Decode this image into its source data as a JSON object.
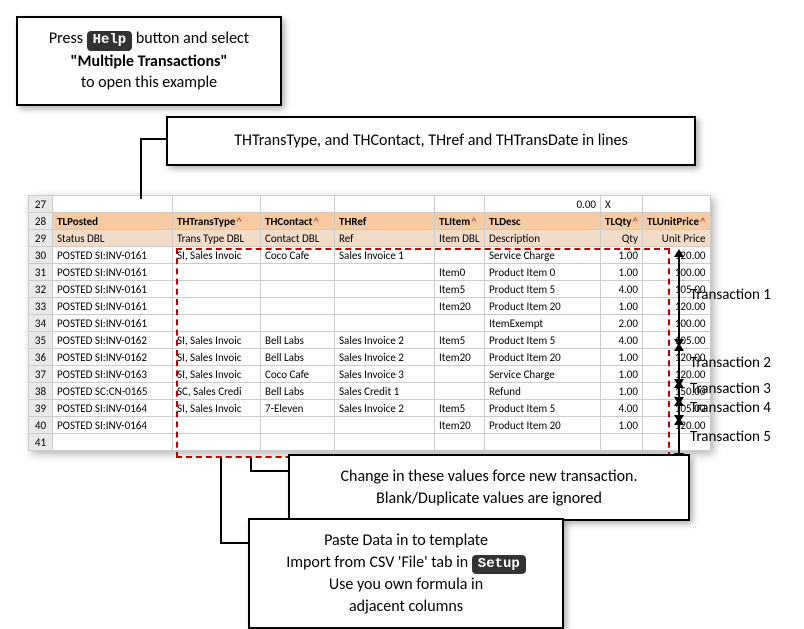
{
  "callouts": {
    "help_line1_pre": "Press ",
    "help_btn": "Help",
    "help_line1_post": " button and select",
    "help_line2": "\"Multiple Transactions\"",
    "help_line3": "to open this example",
    "top_right": "THTransType, and THContact, THref and THTransDate in lines",
    "mid_line1": "Change in these values force new transaction.",
    "mid_line2": "Blank/Duplicate values are ignored",
    "bot_line1": "Paste Data in to template",
    "bot_line2_pre": "Import from CSV 'File' tab in ",
    "bot_pill": "Setup",
    "bot_line3": "Use you own formula in",
    "bot_line4": "adjacent columns"
  },
  "tx_labels": [
    "Transaction 1",
    "Transaction 2",
    "Transaction 3",
    "Transaction 4",
    "Transaction 5"
  ],
  "sheet": {
    "rownums": [
      "27",
      "28",
      "29",
      "30",
      "31",
      "32",
      "33",
      "34",
      "35",
      "36",
      "37",
      "38",
      "39",
      "40",
      "41"
    ],
    "status_cell": {
      "value": "0.00",
      "flag": "X"
    },
    "header1": [
      "TLPosted",
      "THTransType",
      "THContact",
      "THRef",
      "TLItem",
      "TLDesc",
      "TLQty",
      "TLUnitPrice"
    ],
    "header2": [
      "Status DBL",
      "Trans Type DBL",
      "Contact DBL",
      "Ref",
      "Item DBL",
      "Description",
      "Qty",
      "Unit Price"
    ],
    "rows": [
      {
        "posted": "POSTED SI:INV-0161",
        "type": "SI, Sales Invoic",
        "contact": "Coco Cafe",
        "ref": "Sales Invoice 1",
        "item": "",
        "desc": "Service Charge",
        "qty": "1.00",
        "price": "120.00"
      },
      {
        "posted": "POSTED SI:INV-0161",
        "type": "",
        "contact": "",
        "ref": "",
        "item": "Item0",
        "desc": "Product Item 0",
        "qty": "1.00",
        "price": "100.00"
      },
      {
        "posted": "POSTED SI:INV-0161",
        "type": "",
        "contact": "",
        "ref": "",
        "item": "Item5",
        "desc": "Product Item 5",
        "qty": "4.00",
        "price": "105.00"
      },
      {
        "posted": "POSTED SI:INV-0161",
        "type": "",
        "contact": "",
        "ref": "",
        "item": "Item20",
        "desc": "Product Item 20",
        "qty": "1.00",
        "price": "120.00"
      },
      {
        "posted": "POSTED SI:INV-0161",
        "type": "",
        "contact": "",
        "ref": "",
        "item": "",
        "desc": "ItemExempt",
        "qty": "2.00",
        "price": "100.00"
      },
      {
        "posted": "POSTED SI:INV-0162",
        "type": "SI, Sales Invoic",
        "contact": "Bell Labs",
        "ref": "Sales Invoice 2",
        "item": "Item5",
        "desc": "Product Item 5",
        "qty": "4.00",
        "price": "105.00"
      },
      {
        "posted": "POSTED SI:INV-0162",
        "type": "SI, Sales Invoic",
        "contact": "Bell Labs",
        "ref": "Sales Invoice 2",
        "item": "Item20",
        "desc": "Product Item 20",
        "qty": "1.00",
        "price": "120.00"
      },
      {
        "posted": "POSTED SI:INV-0163",
        "type": "SI, Sales Invoic",
        "contact": "Coco Cafe",
        "ref": "Sales Invoice 3",
        "item": "",
        "desc": "Service Charge",
        "qty": "1.00",
        "price": "120.00"
      },
      {
        "posted": "POSTED SC:CN-0165",
        "type": "SC, Sales Credi",
        "contact": "Bell Labs",
        "ref": "Sales Credit 1",
        "item": "",
        "desc": "Refund",
        "qty": "1.00",
        "price": "150.00"
      },
      {
        "posted": "POSTED SI:INV-0164",
        "type": "SI, Sales Invoic",
        "contact": "7-Eleven",
        "ref": "Sales Invoice 2",
        "item": "Item5",
        "desc": "Product Item 5",
        "qty": "4.00",
        "price": "105.00"
      },
      {
        "posted": "POSTED SI:INV-0164",
        "type": "",
        "contact": "",
        "ref": "",
        "item": "Item20",
        "desc": "Product Item 20",
        "qty": "1.00",
        "price": "120.00"
      }
    ]
  }
}
